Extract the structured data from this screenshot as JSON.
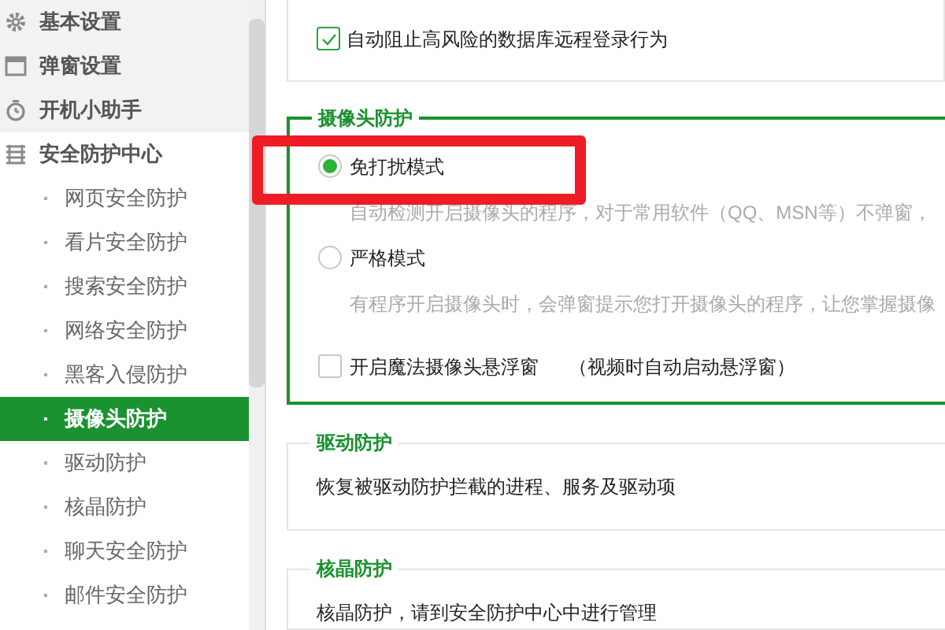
{
  "sidebar": {
    "items": [
      {
        "label": "基本设置",
        "kind": "gear",
        "selected": false
      },
      {
        "label": "弹窗设置",
        "kind": "window",
        "selected": false
      },
      {
        "label": "开机小助手",
        "kind": "timer",
        "selected": false
      },
      {
        "label": "安全防护中心",
        "kind": "list",
        "selected": false,
        "children": [
          {
            "label": "网页安全防护",
            "selected": false
          },
          {
            "label": "看片安全防护",
            "selected": false
          },
          {
            "label": "搜索安全防护",
            "selected": false
          },
          {
            "label": "网络安全防护",
            "selected": false
          },
          {
            "label": "黑客入侵防护",
            "selected": false
          },
          {
            "label": "摄像头防护",
            "selected": true
          },
          {
            "label": "驱动防护",
            "selected": false
          },
          {
            "label": "核晶防护",
            "selected": false
          },
          {
            "label": "聊天安全防护",
            "selected": false
          },
          {
            "label": "邮件安全防护",
            "selected": false
          }
        ]
      }
    ]
  },
  "top_section": {
    "options": [
      {
        "label": "自动阻止高风险的数据库远程登录行为",
        "checked": true
      }
    ]
  },
  "camera_section": {
    "title": "摄像头防护",
    "modes": [
      {
        "label": "免打扰模式",
        "selected": true,
        "description": "自动检测开启摄像头的程序，对于常用软件（QQ、MSN等）不弹窗，"
      },
      {
        "label": "严格模式",
        "selected": false,
        "description": "有程序开启摄像头时，会弹窗提示您打开摄像头的程序，让您掌握摄像"
      }
    ],
    "floating_window": {
      "label": "开启魔法摄像头悬浮窗",
      "note": "（视频时自动启动悬浮窗）",
      "checked": false
    }
  },
  "driver_section": {
    "title": "驱动防护",
    "text": "恢复被驱动防护拦截的进程、服务及驱动项"
  },
  "core_section": {
    "title": "核晶防护",
    "text": "核晶防护，请到安全防护中心中进行管理"
  }
}
